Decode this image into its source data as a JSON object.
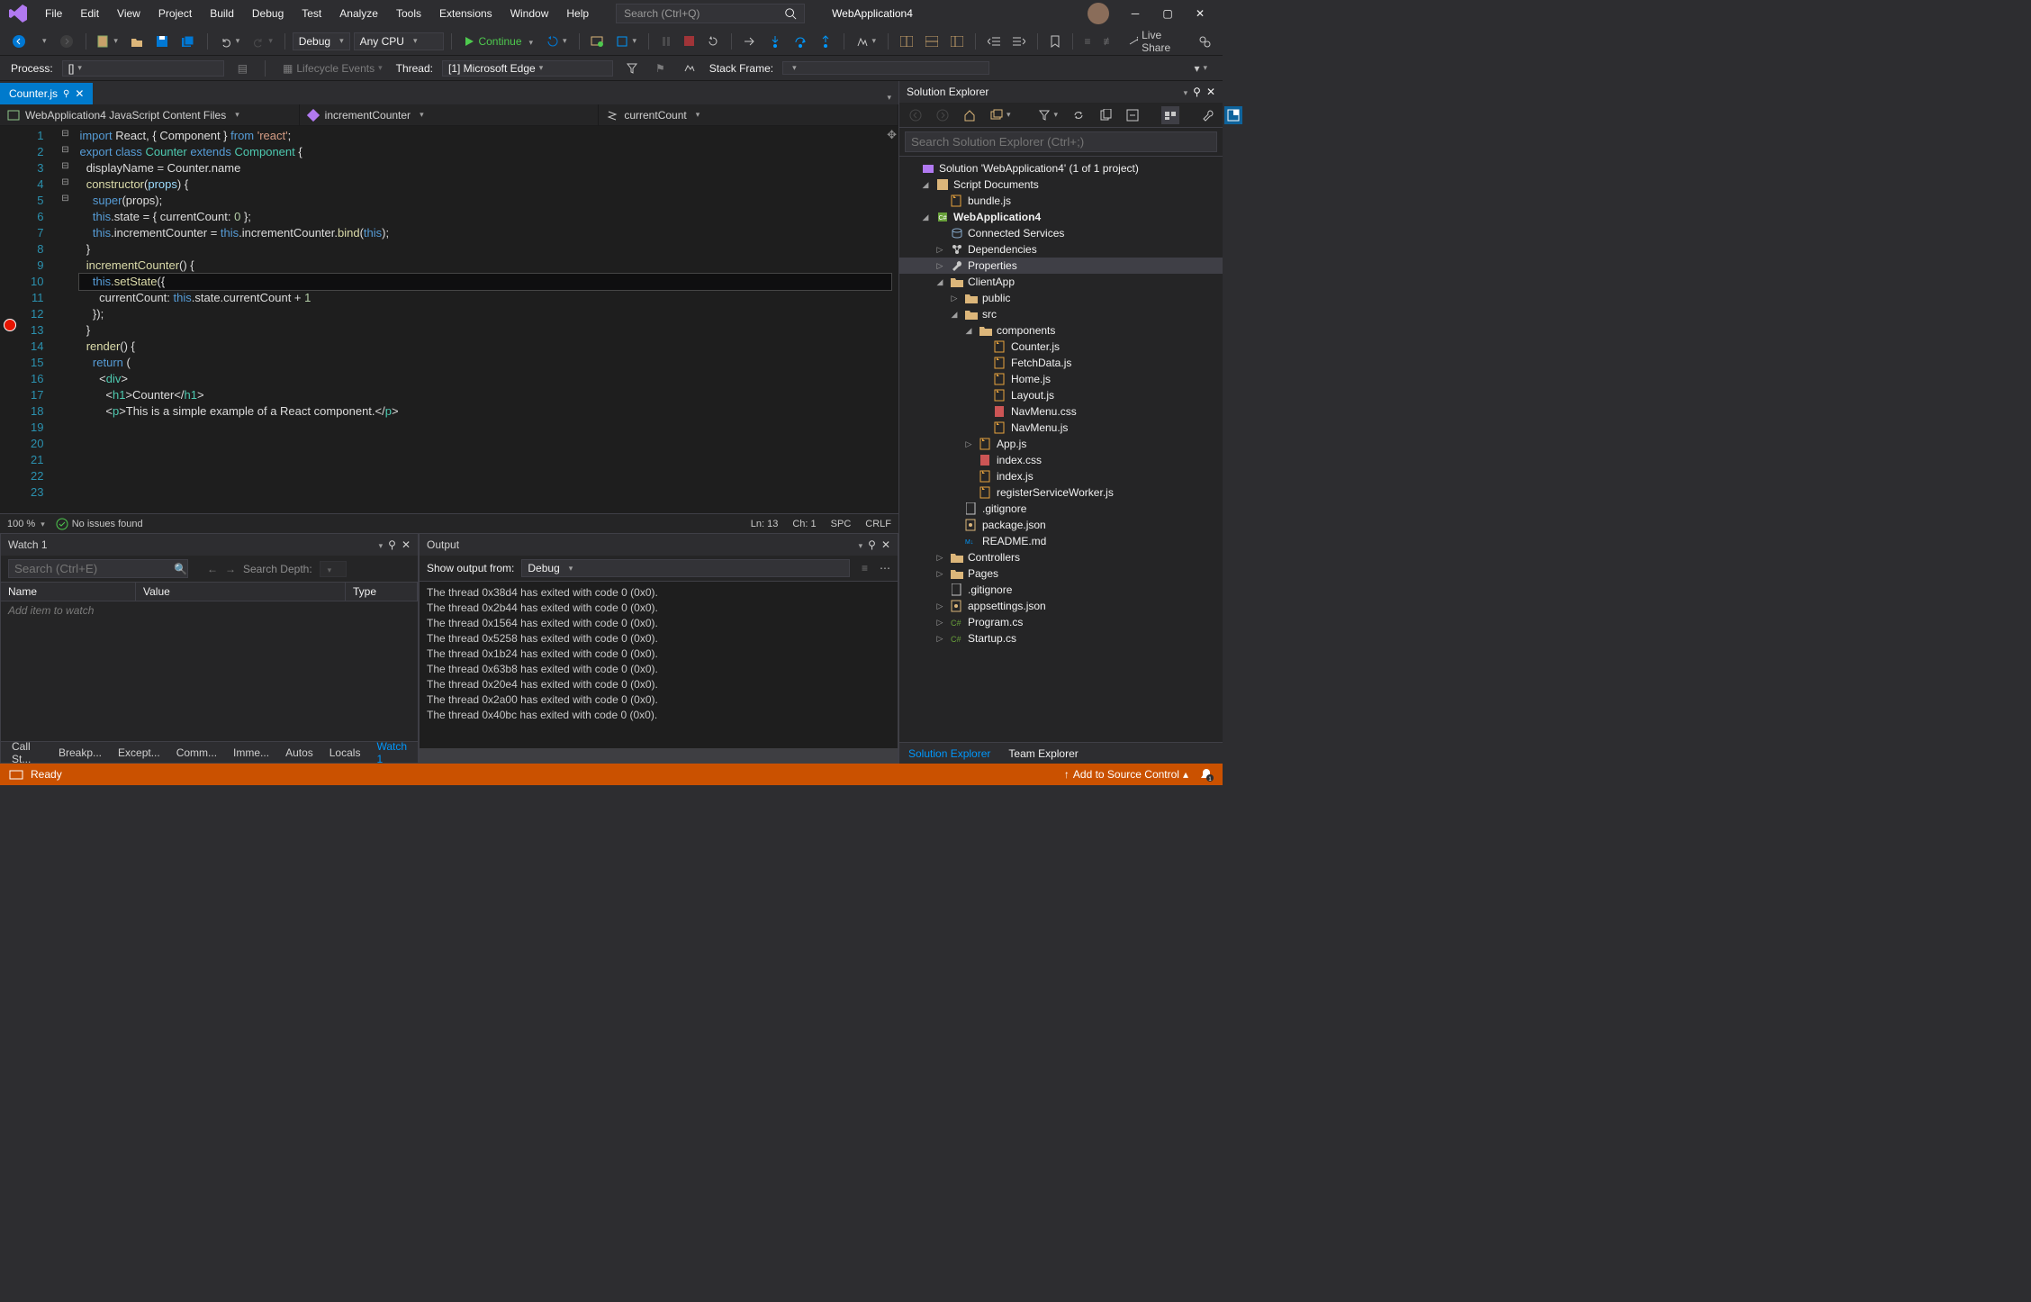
{
  "menu": [
    "File",
    "Edit",
    "View",
    "Project",
    "Build",
    "Debug",
    "Test",
    "Analyze",
    "Tools",
    "Extensions",
    "Window",
    "Help"
  ],
  "search_placeholder": "Search (Ctrl+Q)",
  "app_title": "WebApplication4",
  "toolbar": {
    "config": "Debug",
    "platform": "Any CPU",
    "continue": "Continue",
    "live_share": "Live Share"
  },
  "debugbar": {
    "process": "Process:",
    "process_val": "[]",
    "lifecycle": "Lifecycle Events",
    "thread": "Thread:",
    "thread_val": "[1] Microsoft Edge",
    "stack": "Stack Frame:"
  },
  "tab": {
    "name": "Counter.js"
  },
  "nav": {
    "scope": "WebApplication4 JavaScript Content Files",
    "member": "incrementCounter",
    "sub": "currentCount"
  },
  "code_lines": [
    {
      "n": 1,
      "html": "<span class='kw'>import</span> React, { Component } <span class='kw'>from</span> <span class='str'>'react'</span>;"
    },
    {
      "n": 2,
      "html": ""
    },
    {
      "n": 3,
      "html": "<span class='kw'>export</span> <span class='kw'>class</span> <span class='cls'>Counter</span> <span class='kw'>extends</span> <span class='cls'>Component</span> {",
      "fold": "⊟"
    },
    {
      "n": 4,
      "html": "  displayName = Counter.name"
    },
    {
      "n": 5,
      "html": ""
    },
    {
      "n": 6,
      "html": "  <span class='fn'>constructor</span>(<span class='prm'>props</span>) {",
      "fold": "⊟"
    },
    {
      "n": 7,
      "html": "    <span class='kw'>super</span>(props);"
    },
    {
      "n": 8,
      "html": "    <span class='kw'>this</span>.state = { currentCount: <span class='num'>0</span> };"
    },
    {
      "n": 9,
      "html": "    <span class='kw'>this</span>.incrementCounter = <span class='kw'>this</span>.incrementCounter.<span class='fn'>bind</span>(<span class='kw'>this</span>);"
    },
    {
      "n": 10,
      "html": "  }"
    },
    {
      "n": 11,
      "html": ""
    },
    {
      "n": 12,
      "html": "  <span class='fn'>incrementCounter</span>() {",
      "fold": "⊟"
    },
    {
      "n": 13,
      "html": "    <span class='kw'>this</span>.<span class='fn'>setState</span>({",
      "cur": true
    },
    {
      "n": 14,
      "html": "      currentCount: <span class='kw'>this</span>.state.currentCount + <span class='num'>1</span>"
    },
    {
      "n": 15,
      "html": "    });"
    },
    {
      "n": 16,
      "html": "  }"
    },
    {
      "n": 17,
      "html": ""
    },
    {
      "n": 18,
      "html": "  <span class='fn'>render</span>() {",
      "fold": "⊟"
    },
    {
      "n": 19,
      "html": "    <span class='kw'>return</span> ("
    },
    {
      "n": 20,
      "html": "      &lt;<span class='cls'>div</span>&gt;",
      "fold": "⊟"
    },
    {
      "n": 21,
      "html": "        &lt;<span class='cls'>h1</span>&gt;Counter&lt;/<span class='cls'>h1</span>&gt;"
    },
    {
      "n": 22,
      "html": ""
    },
    {
      "n": 23,
      "html": "        &lt;<span class='cls'>p</span>&gt;This is a simple example of a React component.&lt;/<span class='cls'>p</span>&gt;"
    }
  ],
  "status": {
    "zoom": "100 %",
    "issues": "No issues found",
    "ln": "Ln: 13",
    "ch": "Ch: 1",
    "spc": "SPC",
    "crlf": "CRLF"
  },
  "watch": {
    "title": "Watch 1",
    "search_ph": "Search (Ctrl+E)",
    "depth": "Search Depth:",
    "cols": [
      "Name",
      "Value",
      "Type"
    ],
    "placeholder": "Add item to watch"
  },
  "bottom_tabs": [
    "Call St...",
    "Breakp...",
    "Except...",
    "Comm...",
    "Imme...",
    "Autos",
    "Locals",
    "Watch 1"
  ],
  "output": {
    "title": "Output",
    "from_label": "Show output from:",
    "from_val": "Debug",
    "lines": [
      "The thread 0x38d4 has exited with code 0 (0x0).",
      "The thread 0x2b44 has exited with code 0 (0x0).",
      "The thread 0x1564 has exited with code 0 (0x0).",
      "The thread 0x5258 has exited with code 0 (0x0).",
      "The thread 0x1b24 has exited with code 0 (0x0).",
      "The thread 0x63b8 has exited with code 0 (0x0).",
      "The thread 0x20e4 has exited with code 0 (0x0).",
      "The thread 0x2a00 has exited with code 0 (0x0).",
      "The thread 0x40bc has exited with code 0 (0x0)."
    ]
  },
  "solution": {
    "title": "Solution Explorer",
    "search_ph": "Search Solution Explorer (Ctrl+;)",
    "root": "Solution 'WebApplication4' (1 of 1 project)",
    "tree": [
      {
        "d": 1,
        "tw": "�άν",
        "ic": "script",
        "t": "Script Documents",
        "exp": "▿"
      },
      {
        "d": 2,
        "ic": "js",
        "t": "bundle.js"
      },
      {
        "d": 1,
        "ic": "csproj",
        "t": "WebApplication4",
        "bold": true,
        "exp": "▿"
      },
      {
        "d": 2,
        "ic": "conn",
        "t": "Connected Services"
      },
      {
        "d": 2,
        "ic": "dep",
        "t": "Dependencies",
        "exp": "▹"
      },
      {
        "d": 2,
        "ic": "wrench",
        "t": "Properties",
        "exp": "▹",
        "sel": true
      },
      {
        "d": 2,
        "ic": "fld",
        "t": "ClientApp",
        "exp": "▿"
      },
      {
        "d": 3,
        "ic": "fld",
        "t": "public",
        "exp": "▹"
      },
      {
        "d": 3,
        "ic": "fld",
        "t": "src",
        "exp": "▿"
      },
      {
        "d": 4,
        "ic": "fld",
        "t": "components",
        "exp": "▿"
      },
      {
        "d": 5,
        "ic": "js",
        "t": "Counter.js"
      },
      {
        "d": 5,
        "ic": "js",
        "t": "FetchData.js"
      },
      {
        "d": 5,
        "ic": "js",
        "t": "Home.js"
      },
      {
        "d": 5,
        "ic": "js",
        "t": "Layout.js"
      },
      {
        "d": 5,
        "ic": "css",
        "t": "NavMenu.css"
      },
      {
        "d": 5,
        "ic": "js",
        "t": "NavMenu.js"
      },
      {
        "d": 4,
        "ic": "js",
        "t": "App.js",
        "exp": "▹"
      },
      {
        "d": 4,
        "ic": "css",
        "t": "index.css"
      },
      {
        "d": 4,
        "ic": "js",
        "t": "index.js"
      },
      {
        "d": 4,
        "ic": "js",
        "t": "registerServiceWorker.js"
      },
      {
        "d": 3,
        "ic": "file",
        "t": ".gitignore"
      },
      {
        "d": 3,
        "ic": "json",
        "t": "package.json"
      },
      {
        "d": 3,
        "ic": "md",
        "t": "README.md"
      },
      {
        "d": 2,
        "ic": "fld",
        "t": "Controllers",
        "exp": "▹"
      },
      {
        "d": 2,
        "ic": "fld",
        "t": "Pages",
        "exp": "▹"
      },
      {
        "d": 2,
        "ic": "file",
        "t": ".gitignore"
      },
      {
        "d": 2,
        "ic": "json",
        "t": "appsettings.json",
        "exp": "▹"
      },
      {
        "d": 2,
        "ic": "cs",
        "t": "Program.cs",
        "exp": "▹"
      },
      {
        "d": 2,
        "ic": "cs",
        "t": "Startup.cs",
        "exp": "▹"
      }
    ],
    "tabs": [
      "Solution Explorer",
      "Team Explorer"
    ]
  },
  "statusbar": {
    "ready": "Ready",
    "source": "Add to Source Control"
  }
}
